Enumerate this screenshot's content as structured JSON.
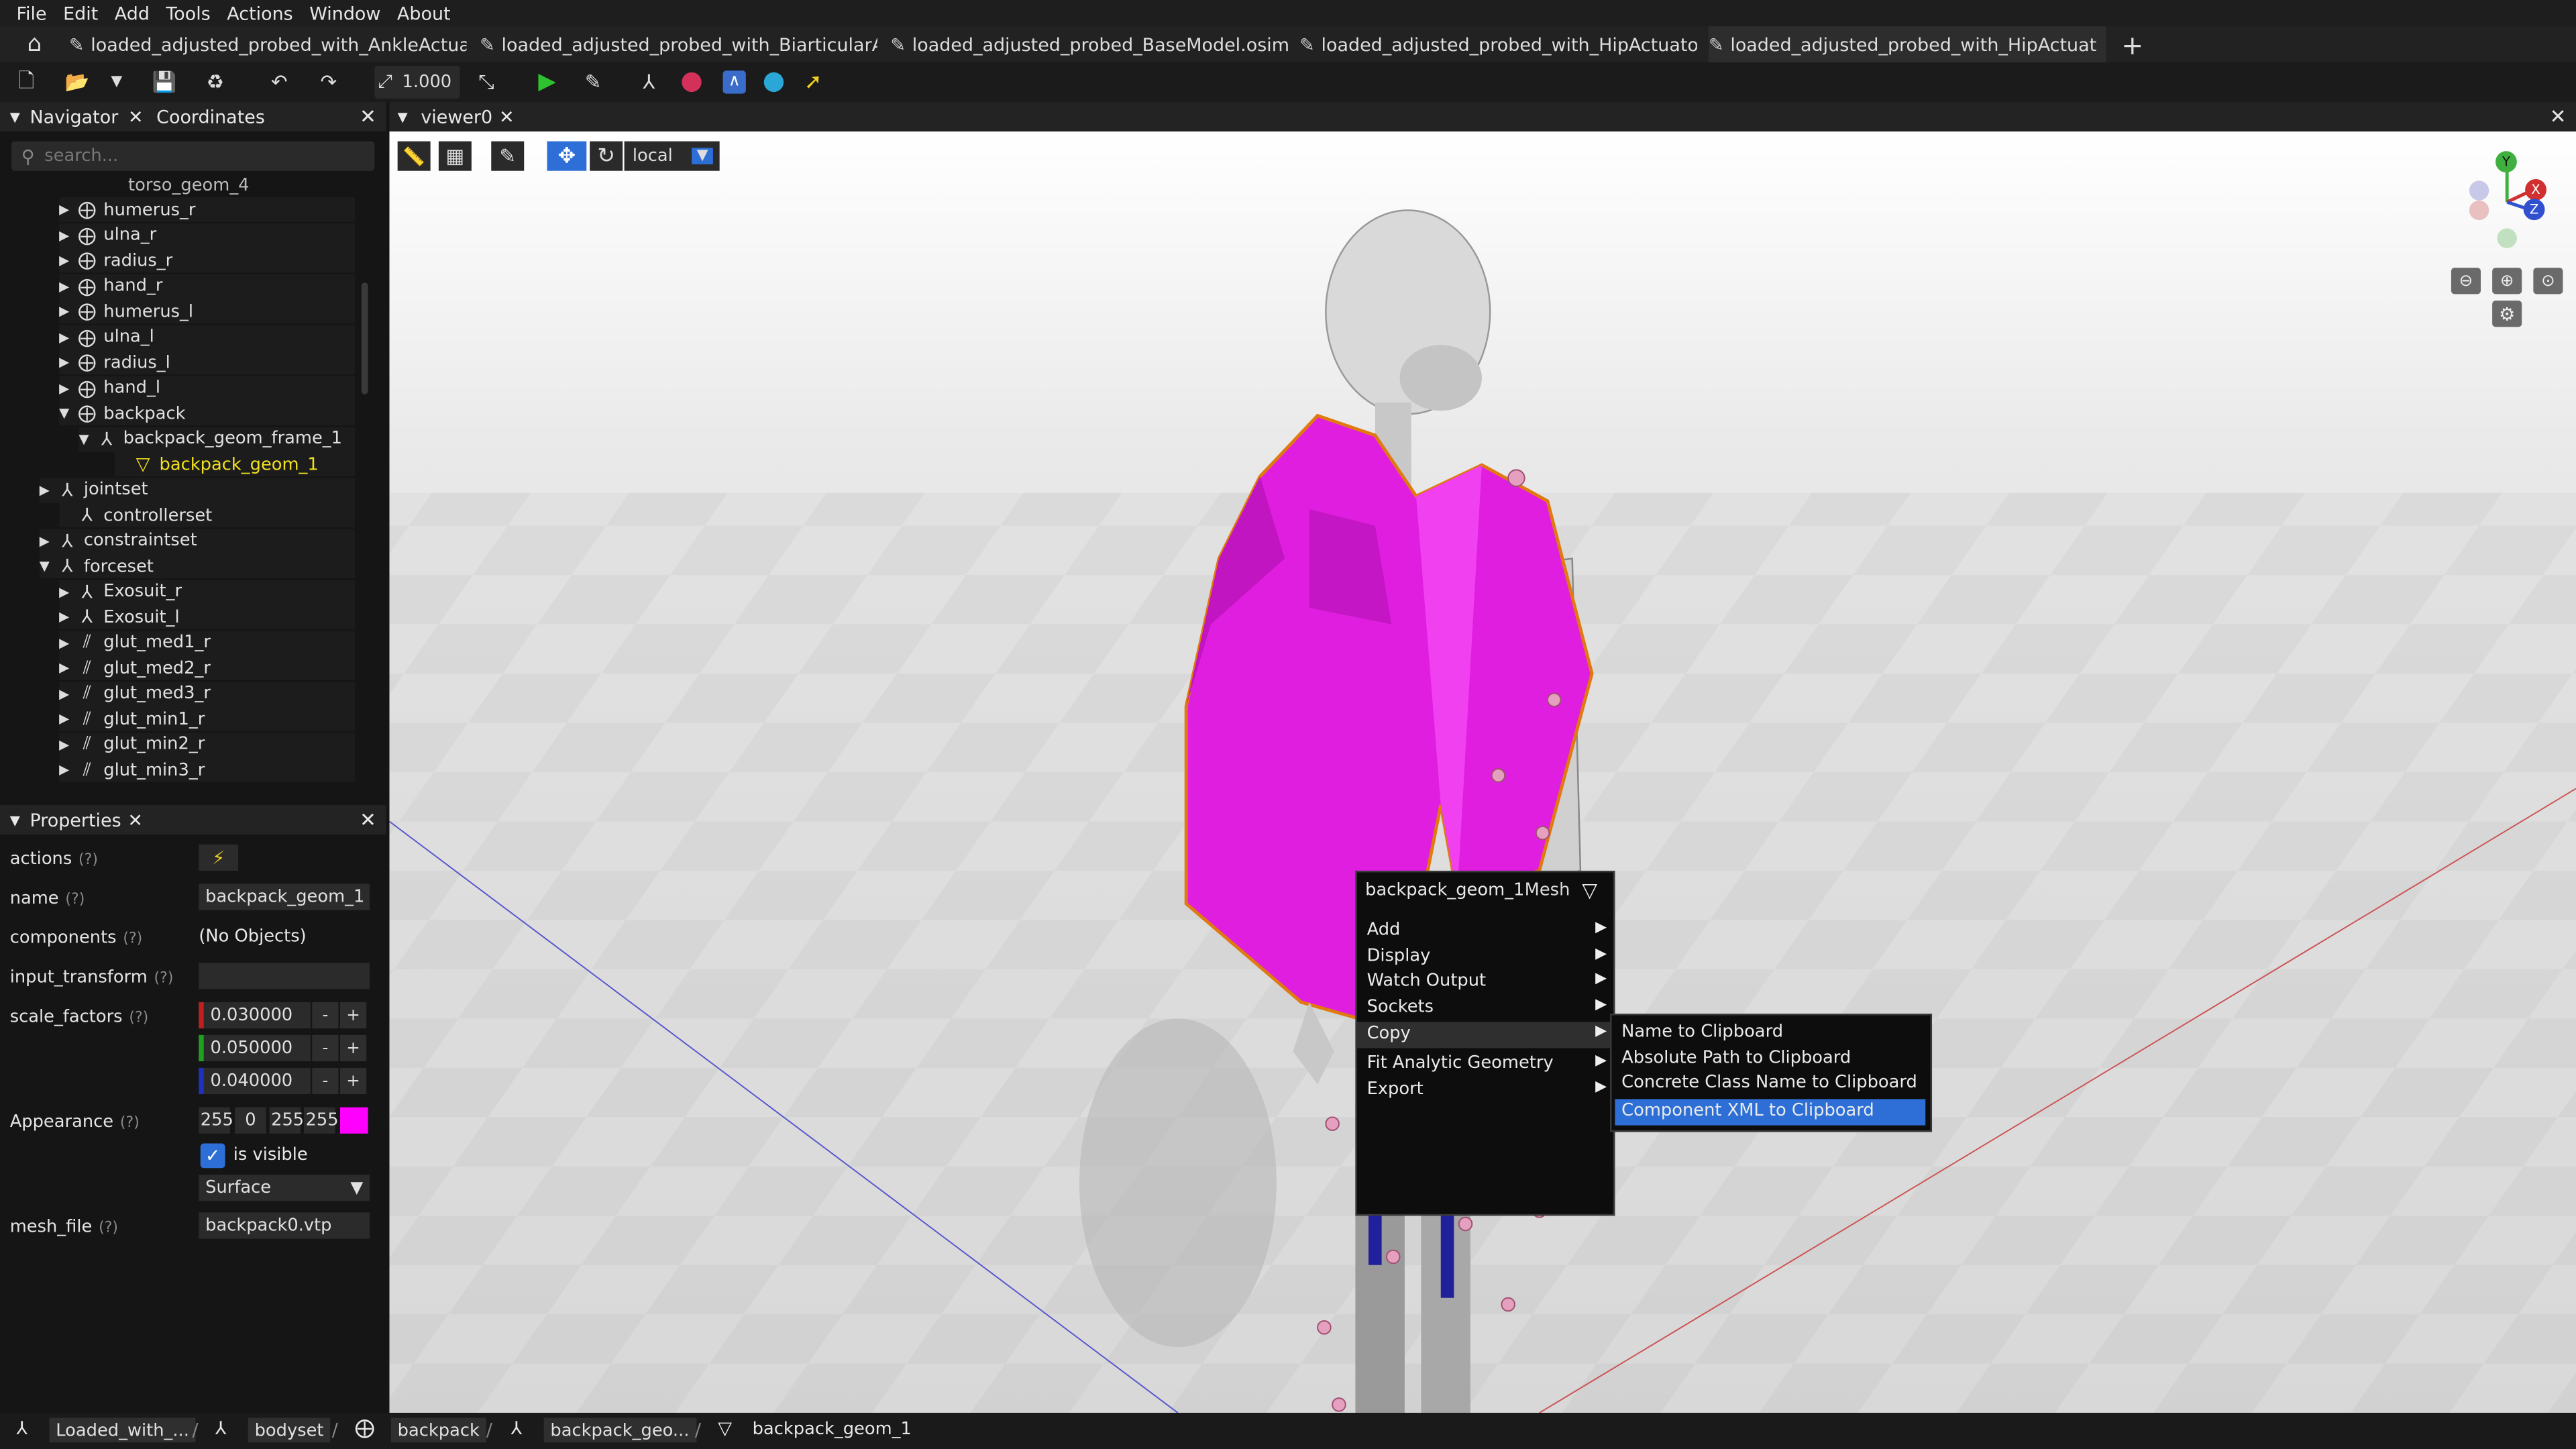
{
  "menubar": [
    "File",
    "Edit",
    "Add",
    "Tools",
    "Actions",
    "Window",
    "About"
  ],
  "tabs": [
    {
      "label": "loaded_adjusted_probed_with_AnkleActuat..."
    },
    {
      "label": "loaded_adjusted_probed_with_BiarticularA..."
    },
    {
      "label": "loaded_adjusted_probed_BaseModel.osim"
    },
    {
      "label": "loaded_adjusted_probed_with_HipActuator..."
    },
    {
      "label": "loaded_adjusted_probed_with_HipActuat"
    }
  ],
  "toolbar": {
    "scale_value": "1.000"
  },
  "navigator": {
    "tab_navigator": "Navigator",
    "tab_coordinates": "Coordinates",
    "search_placeholder": "search...",
    "partial_row": "torso_geom_4",
    "rows": [
      {
        "label": "humerus_r"
      },
      {
        "label": "ulna_r"
      },
      {
        "label": "radius_r"
      },
      {
        "label": "hand_r"
      },
      {
        "label": "humerus_l"
      },
      {
        "label": "ulna_l"
      },
      {
        "label": "radius_l"
      },
      {
        "label": "hand_l"
      },
      {
        "label": "backpack"
      },
      {
        "label": "backpack_geom_frame_1"
      },
      {
        "label": "backpack_geom_1"
      },
      {
        "label": "jointset"
      },
      {
        "label": "controllerset"
      },
      {
        "label": "constraintset"
      },
      {
        "label": "forceset"
      },
      {
        "label": "Exosuit_r"
      },
      {
        "label": "Exosuit_l"
      },
      {
        "label": "glut_med1_r"
      },
      {
        "label": "glut_med2_r"
      },
      {
        "label": "glut_med3_r"
      },
      {
        "label": "glut_min1_r"
      },
      {
        "label": "glut_min2_r"
      },
      {
        "label": "glut_min3_r"
      }
    ]
  },
  "properties": {
    "title": "Properties",
    "help": "(?)",
    "labels": {
      "actions": "actions",
      "name": "name",
      "components": "components",
      "input_transform": "input_transform",
      "scale_factors": "scale_factors",
      "appearance": "Appearance",
      "mesh_file": "mesh_file"
    },
    "name_value": "backpack_geom_1",
    "components_value": "(No Objects)",
    "scale_x": "0.030000",
    "scale_y": "0.050000",
    "scale_z": "0.040000",
    "color_r": "255",
    "color_g": "0",
    "color_b": "255",
    "color_a": "255",
    "is_visible_label": "is visible",
    "representation": "Surface",
    "mesh_file_value": "backpack0.vtp"
  },
  "viewer": {
    "tab_label": "viewer0",
    "frame_mode": "local",
    "axis_x": "X",
    "axis_y": "Y",
    "axis_z": "Z"
  },
  "context_menu": {
    "title": "backpack_geom_1",
    "type": "Mesh",
    "items": [
      "Add",
      "Display",
      "Watch Output",
      "Sockets",
      "Copy",
      "Fit Analytic Geometry",
      "Export"
    ],
    "copy_submenu": [
      "Name to Clipboard",
      "Absolute Path to Clipboard",
      "Concrete Class Name to Clipboard",
      "Component XML to Clipboard"
    ]
  },
  "statusbar": {
    "crumbs": [
      "Loaded_with_...",
      "bodyset",
      "backpack",
      "backpack_geo...",
      "backpack_geom_1"
    ]
  },
  "colors": {
    "accent": "#2d6fd6",
    "selection_outline": "#e07a10",
    "backpack": "#e01ee0",
    "selected_tree": "#f0e020"
  }
}
